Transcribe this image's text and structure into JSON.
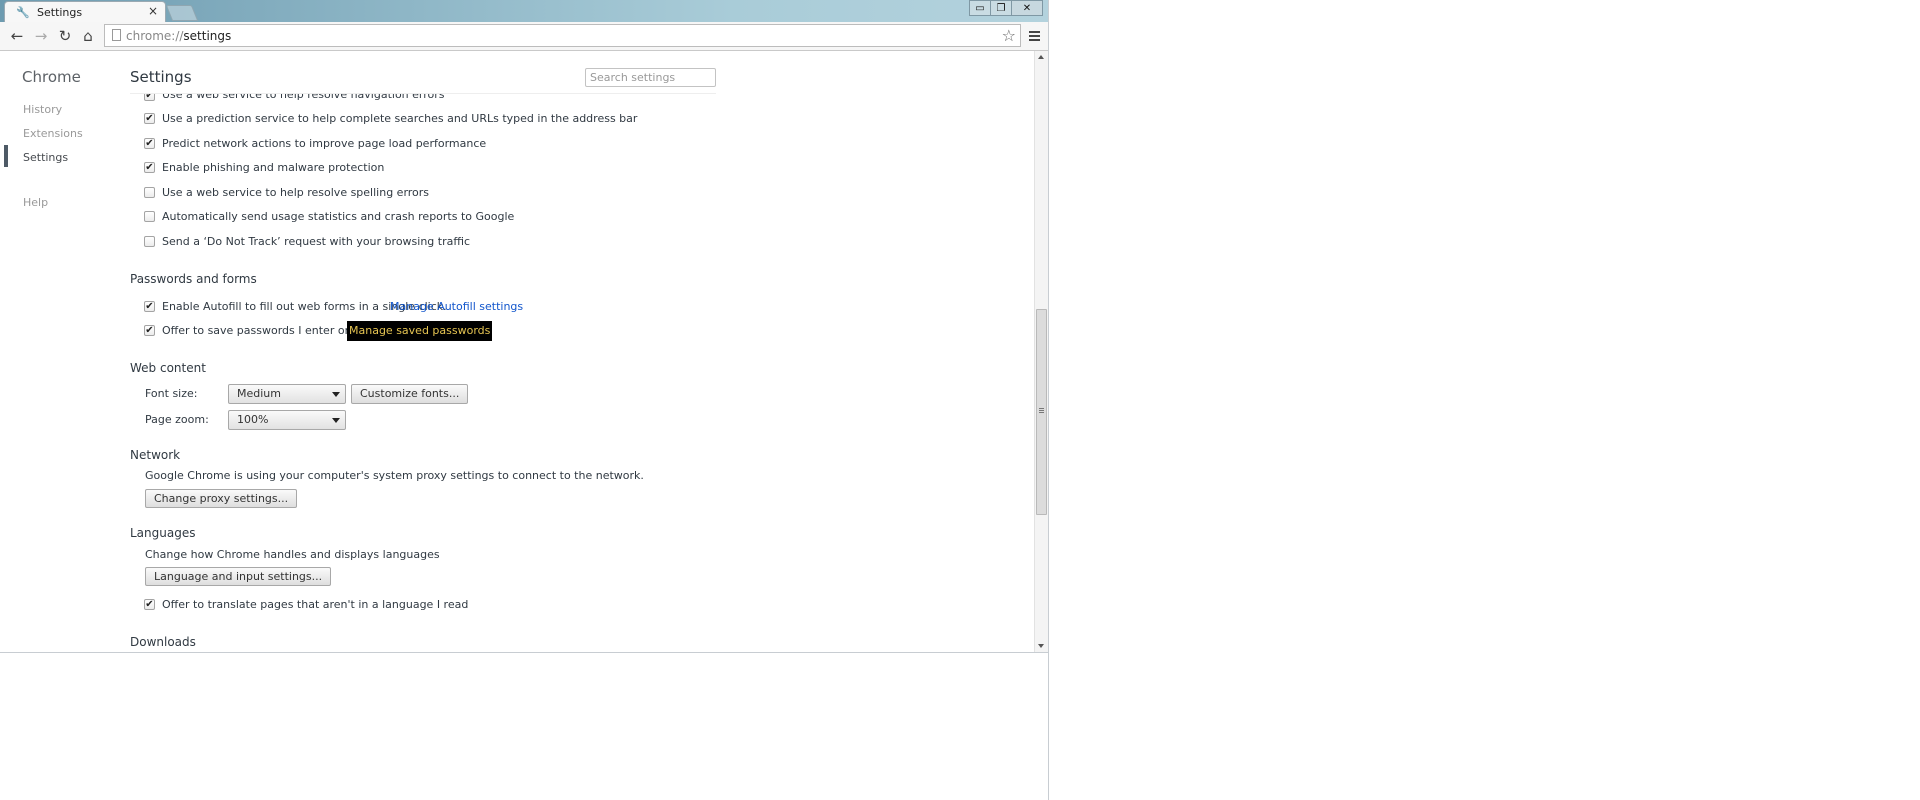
{
  "browser": {
    "tab_title": "Settings",
    "tab_icon": "wrench-icon",
    "tab_close": "×",
    "window_controls": [
      "minimize-icon",
      "restore-icon",
      "close-icon"
    ],
    "window_control_glyphs": [
      "▭",
      "❐",
      "✕"
    ],
    "omnibox_scheme": "chrome://",
    "omnibox_host": "settings"
  },
  "nav": {
    "title": "Chrome",
    "items": [
      {
        "label": "History"
      },
      {
        "label": "Extensions"
      },
      {
        "label": "Settings",
        "selected": true
      },
      {
        "label": "Help"
      }
    ]
  },
  "header": {
    "title": "Settings",
    "search_placeholder": "Search settings"
  },
  "privacy": {
    "options": [
      {
        "label": "Use a web service to help resolve navigation errors",
        "checked": true
      },
      {
        "label": "Use a prediction service to help complete searches and URLs typed in the address bar",
        "checked": true
      },
      {
        "label": "Predict network actions to improve page load performance",
        "checked": true
      },
      {
        "label": "Enable phishing and malware protection",
        "checked": true
      },
      {
        "label": "Use a web service to help resolve spelling errors",
        "checked": false
      },
      {
        "label": "Automatically send usage statistics and crash reports to Google",
        "checked": false
      },
      {
        "label": "Send a ‘Do Not Track’ request with your browsing traffic",
        "checked": false
      }
    ]
  },
  "passwords": {
    "title": "Passwords and forms",
    "autofill_label": "Enable Autofill to fill out web forms in a single click.",
    "autofill_link": "Manage Autofill settings",
    "passwords_label": "Offer to save passwords I enter on the web",
    "passwords_link": "Manage saved passwords"
  },
  "web_content": {
    "title": "Web content",
    "font_size_label": "Font size:",
    "font_size_value": "Medium",
    "customize_fonts": "Customize fonts...",
    "page_zoom_label": "Page zoom:",
    "page_zoom_value": "100%"
  },
  "network": {
    "title": "Network",
    "description": "Google Chrome is using your computer's system proxy settings to connect to the network.",
    "button": "Change proxy settings..."
  },
  "languages": {
    "title": "Languages",
    "description": "Change how Chrome handles and displays languages",
    "button": "Language and input settings...",
    "translate_label": "Offer to translate pages that aren't in a language I read"
  },
  "downloads": {
    "title": "Downloads"
  },
  "colors": {
    "link": "#1155cc",
    "highlight_bg": "#000000",
    "highlight_text": "#e5c452"
  }
}
